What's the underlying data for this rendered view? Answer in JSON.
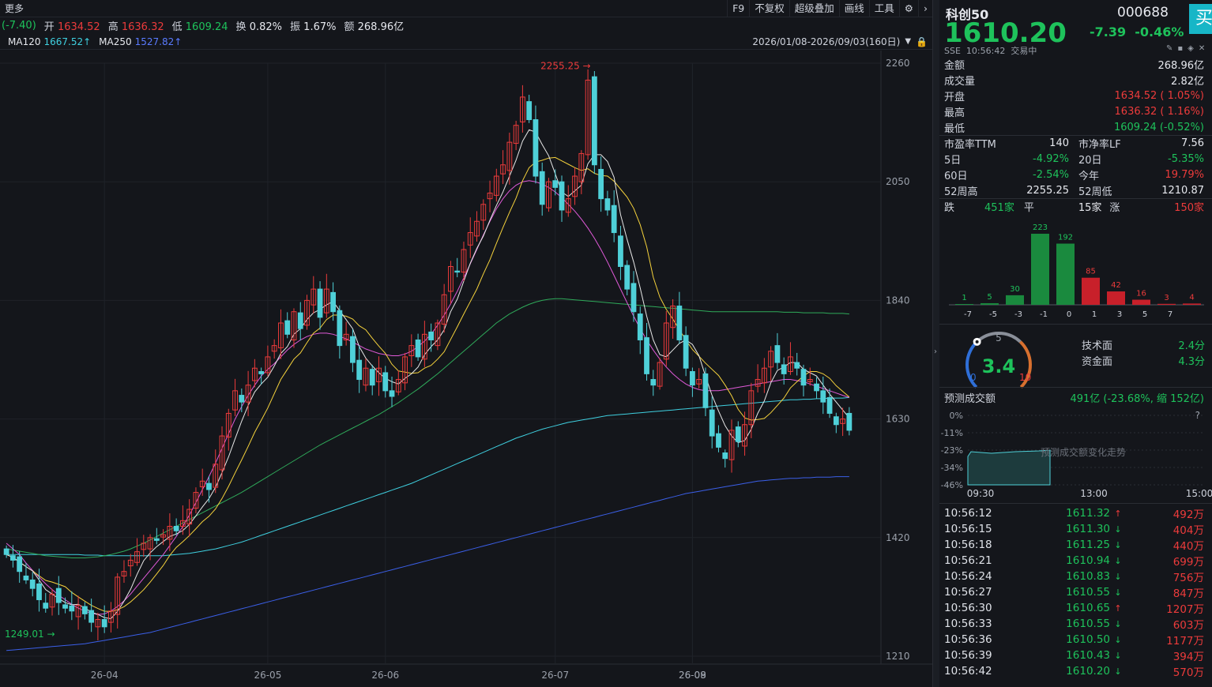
{
  "toolbar": {
    "more": "更多",
    "items": [
      "F9",
      "不复权",
      "超级叠加",
      "画线",
      "工具"
    ]
  },
  "quote": {
    "change": "(-7.40)",
    "open_label": "开",
    "open": "1634.52",
    "high_label": "高",
    "high": "1636.32",
    "low_label": "低",
    "low": "1609.24",
    "turnover_label": "换",
    "turnover": "0.82%",
    "amplitude_label": "振",
    "amplitude": "1.67%",
    "amount_label": "额",
    "amount": "268.96亿"
  },
  "ma": {
    "ma120_label": "MA120",
    "ma120": "1667.52↑",
    "ma250_label": "MA250",
    "ma250": "1527.82↑",
    "range": "2026/01/08-2026/09/03(160日)"
  },
  "colors": {
    "up": "#ec3b3b",
    "down": "#4fd0d8",
    "ma5": "#e8e8e8",
    "ma10": "#f5d23c",
    "ma20": "#e05ad8",
    "ma60": "#2faa5a",
    "ma120": "#3fd0e0",
    "ma250": "#3b5fe8"
  },
  "chart_data": {
    "type": "candlestick",
    "y_ticks": [
      "2260",
      "2050",
      "1840",
      "1630",
      "1420",
      "1210"
    ],
    "ylim": [
      1210,
      2260
    ],
    "x_ticks": [
      "26-04",
      "26-05",
      "26-06",
      "26-07",
      "26-08",
      "26-09"
    ],
    "annotations": {
      "high": "2255.25",
      "low": "1249.01"
    },
    "closes": [
      1390,
      1380,
      1360,
      1345,
      1330,
      1310,
      1295,
      1320,
      1305,
      1295,
      1290,
      1300,
      1285,
      1270,
      1275,
      1262,
      1290,
      1350,
      1360,
      1380,
      1395,
      1410,
      1420,
      1415,
      1425,
      1440,
      1432,
      1450,
      1470,
      1500,
      1520,
      1505,
      1550,
      1600,
      1640,
      1680,
      1660,
      1690,
      1720,
      1710,
      1740,
      1760,
      1800,
      1780,
      1820,
      1790,
      1840,
      1860,
      1810,
      1860,
      1820,
      1760,
      1780,
      1730,
      1700,
      1720,
      1690,
      1720,
      1680,
      1670,
      1700,
      1740,
      1760,
      1740,
      1780,
      1770,
      1800,
      1850,
      1900,
      1890,
      1930,
      1960,
      1980,
      2010,
      2030,
      2060,
      2080,
      2120,
      2150,
      2200,
      2160,
      2060,
      2010,
      2050,
      2040,
      2000,
      2020,
      2060,
      2100,
      2230,
      2080,
      2020,
      2000,
      1960,
      1900,
      1860,
      1820,
      1770,
      1710,
      1690,
      1730,
      1800,
      1830,
      1770,
      1720,
      1690,
      1700,
      1650,
      1600,
      1580,
      1560,
      1610,
      1590,
      1620,
      1680,
      1700,
      1720,
      1750,
      1730,
      1710,
      1740,
      1720,
      1690,
      1700,
      1680,
      1660,
      1640,
      1620,
      1630,
      1610
    ],
    "ma20": [
      1410,
      1400,
      1390,
      1375,
      1362,
      1350,
      1338,
      1328,
      1318,
      1310,
      1302,
      1295,
      1290,
      1286,
      1284,
      1285,
      1290,
      1298,
      1308,
      1320,
      1334,
      1348,
      1362,
      1376,
      1390,
      1406,
      1422,
      1440,
      1460,
      1482,
      1505,
      1528,
      1552,
      1578,
      1604,
      1630,
      1652,
      1672,
      1690,
      1706,
      1718,
      1728,
      1740,
      1752,
      1762,
      1770,
      1776,
      1780,
      1782,
      1782,
      1780,
      1776,
      1772,
      1766,
      1760,
      1754,
      1750,
      1746,
      1744,
      1742,
      1742,
      1745,
      1750,
      1758,
      1768,
      1780,
      1796,
      1814,
      1834,
      1856,
      1880,
      1905,
      1930,
      1956,
      1980,
      2002,
      2020,
      2034,
      2044,
      2050,
      2052,
      2050,
      2046,
      2040,
      2032,
      2022,
      2010,
      1998,
      1984,
      1968,
      1950,
      1930,
      1908,
      1884,
      1860,
      1836,
      1812,
      1790,
      1770,
      1752,
      1736,
      1722,
      1710,
      1700,
      1692,
      1686,
      1682,
      1680,
      1680,
      1680,
      1682,
      1684,
      1686,
      1688,
      1690,
      1692,
      1694,
      1696,
      1698,
      1700,
      1700,
      1698,
      1696,
      1692,
      1688,
      1684,
      1680,
      1676,
      1672,
      1668
    ],
    "ma60": [
      1400,
      1398,
      1396,
      1394,
      1392,
      1390,
      1388,
      1387,
      1386,
      1385,
      1384,
      1384,
      1384,
      1385,
      1386,
      1388,
      1390,
      1393,
      1396,
      1400,
      1405,
      1410,
      1416,
      1422,
      1428,
      1434,
      1440,
      1446,
      1452,
      1458,
      1464,
      1470,
      1476,
      1482,
      1488,
      1494,
      1500,
      1507,
      1514,
      1521,
      1528,
      1535,
      1542,
      1549,
      1556,
      1563,
      1570,
      1577,
      1584,
      1590,
      1596,
      1602,
      1608,
      1614,
      1620,
      1626,
      1632,
      1638,
      1645,
      1652,
      1659,
      1667,
      1675,
      1683,
      1692,
      1701,
      1710,
      1720,
      1730,
      1740,
      1750,
      1760,
      1770,
      1780,
      1790,
      1800,
      1808,
      1816,
      1822,
      1828,
      1833,
      1837,
      1840,
      1842,
      1843,
      1843,
      1842,
      1841,
      1840,
      1839,
      1838,
      1837,
      1836,
      1835,
      1834,
      1833,
      1832,
      1831,
      1830,
      1829,
      1828,
      1827,
      1826,
      1825,
      1824,
      1823,
      1822,
      1821,
      1820,
      1820,
      1820,
      1820,
      1820,
      1820,
      1820,
      1820,
      1820,
      1820,
      1820,
      1819,
      1819,
      1819,
      1818,
      1818,
      1818,
      1818,
      1817,
      1817,
      1817,
      1816
    ],
    "ma120": [
      1390,
      1390,
      1390,
      1390,
      1390,
      1390,
      1390,
      1390,
      1390,
      1390,
      1390,
      1390,
      1389,
      1389,
      1389,
      1388,
      1388,
      1388,
      1388,
      1388,
      1388,
      1388,
      1388,
      1388,
      1388,
      1389,
      1390,
      1391,
      1392,
      1394,
      1396,
      1398,
      1400,
      1403,
      1406,
      1409,
      1412,
      1416,
      1420,
      1424,
      1428,
      1432,
      1436,
      1440,
      1444,
      1448,
      1452,
      1456,
      1460,
      1464,
      1468,
      1472,
      1476,
      1480,
      1484,
      1488,
      1492,
      1496,
      1500,
      1504,
      1508,
      1512,
      1516,
      1521,
      1526,
      1531,
      1536,
      1541,
      1546,
      1551,
      1556,
      1561,
      1566,
      1571,
      1576,
      1581,
      1586,
      1591,
      1596,
      1600,
      1604,
      1608,
      1612,
      1615,
      1618,
      1621,
      1624,
      1626,
      1628,
      1630,
      1632,
      1634,
      1636,
      1637,
      1638,
      1639,
      1640,
      1641,
      1642,
      1643,
      1644,
      1645,
      1646,
      1647,
      1648,
      1649,
      1650,
      1651,
      1652,
      1653,
      1654,
      1655,
      1656,
      1657,
      1658,
      1659,
      1660,
      1661,
      1662,
      1663,
      1664,
      1664,
      1665,
      1665,
      1666,
      1666,
      1667,
      1667,
      1667,
      1668
    ],
    "ma250": [
      1220,
      1221,
      1222,
      1223,
      1224,
      1225,
      1226,
      1227,
      1228,
      1229,
      1230,
      1231,
      1232,
      1234,
      1236,
      1238,
      1240,
      1242,
      1244,
      1246,
      1248,
      1250,
      1252,
      1255,
      1258,
      1261,
      1264,
      1267,
      1270,
      1273,
      1276,
      1279,
      1282,
      1285,
      1288,
      1291,
      1294,
      1297,
      1300,
      1303,
      1306,
      1309,
      1312,
      1315,
      1318,
      1321,
      1324,
      1327,
      1330,
      1333,
      1336,
      1339,
      1342,
      1345,
      1348,
      1351,
      1354,
      1357,
      1360,
      1363,
      1366,
      1369,
      1372,
      1375,
      1378,
      1381,
      1384,
      1387,
      1390,
      1393,
      1396,
      1399,
      1402,
      1405,
      1408,
      1411,
      1414,
      1417,
      1420,
      1423,
      1426,
      1429,
      1432,
      1435,
      1438,
      1441,
      1444,
      1447,
      1450,
      1453,
      1456,
      1459,
      1462,
      1465,
      1468,
      1471,
      1474,
      1477,
      1480,
      1483,
      1486,
      1489,
      1492,
      1495,
      1498,
      1500,
      1502,
      1504,
      1506,
      1508,
      1510,
      1512,
      1514,
      1516,
      1518,
      1520,
      1521,
      1522,
      1523,
      1524,
      1525,
      1525,
      1526,
      1526,
      1527,
      1527,
      1527,
      1528,
      1528,
      1528
    ]
  },
  "right": {
    "name": "科创50",
    "code": "000688",
    "buy": "买",
    "price": "1610.20",
    "change": "-7.39",
    "change_pct": "-0.46%",
    "exchange": "SSE",
    "time": "10:56:42",
    "status": "交易中",
    "stats": [
      {
        "label": "金额",
        "value": "268.96亿",
        "color": "#e6e8ee"
      },
      {
        "label": "成交量",
        "value": "2.82亿",
        "color": "#e6e8ee"
      },
      {
        "label": "开盘",
        "value": "1634.52 ( 1.05%)",
        "color": "#ec3b3b"
      },
      {
        "label": "最高",
        "value": "1636.32 ( 1.16%)",
        "color": "#ec3b3b"
      },
      {
        "label": "最低",
        "value": "1609.24 (-0.52%)",
        "color": "#1ec25b"
      }
    ],
    "ratios": [
      {
        "l1": "市盈率TTM",
        "v1": "140",
        "c1": "#e6e8ee",
        "l2": "市净率LF",
        "v2": "7.56",
        "c2": "#e6e8ee"
      },
      {
        "l1": "5日",
        "v1": "-4.92%",
        "c1": "#1ec25b",
        "l2": "20日",
        "v2": "-5.35%",
        "c2": "#1ec25b"
      },
      {
        "l1": "60日",
        "v1": "-2.54%",
        "c1": "#1ec25b",
        "l2": "今年",
        "v2": "19.79%",
        "c2": "#ec3b3b"
      },
      {
        "l1": "52周高",
        "v1": "2255.25",
        "c1": "#e6e8ee",
        "l2": "52周低",
        "v2": "1210.87",
        "c2": "#e6e8ee"
      }
    ],
    "breadth": {
      "down_label": "跌",
      "down": "451家",
      "flat_label": "平",
      "flat": "15家",
      "up_label": "涨",
      "up": "150家"
    },
    "dist": {
      "labels": [
        "-7",
        "-5",
        "-3",
        "-1",
        "0",
        "1",
        "3",
        "5",
        "7"
      ],
      "values": [
        1,
        5,
        30,
        223,
        192,
        85,
        42,
        16,
        3,
        4
      ],
      "value_labels": [
        "1",
        "5",
        "30",
        "223",
        "192",
        "85",
        "42",
        "16",
        "3",
        "4"
      ]
    },
    "score": {
      "value": "3.4",
      "min": "0",
      "mid": "5",
      "max": "10",
      "tech_label": "技术面",
      "tech": "2.4分",
      "fund_label": "资金面",
      "fund": "4.3分"
    },
    "forecast": {
      "label": "预测成交额",
      "value": "491亿 (-23.68%, 缩 152亿)",
      "y_ticks": [
        "0%",
        "-11%",
        "-23%",
        "-34%",
        "-46%"
      ],
      "x_ticks": [
        "09:30",
        "13:00",
        "15:00"
      ],
      "note": "预测成交额变化走势",
      "help": "?"
    },
    "ticks": [
      {
        "time": "10:56:12",
        "price": "1611.32",
        "dir": "up",
        "vol": "492万"
      },
      {
        "time": "10:56:15",
        "price": "1611.30",
        "dir": "down",
        "vol": "404万"
      },
      {
        "time": "10:56:18",
        "price": "1611.25",
        "dir": "down",
        "vol": "440万"
      },
      {
        "time": "10:56:21",
        "price": "1610.94",
        "dir": "down",
        "vol": "699万"
      },
      {
        "time": "10:56:24",
        "price": "1610.83",
        "dir": "down",
        "vol": "756万"
      },
      {
        "time": "10:56:27",
        "price": "1610.55",
        "dir": "down",
        "vol": "847万"
      },
      {
        "time": "10:56:30",
        "price": "1610.65",
        "dir": "up",
        "vol": "1207万"
      },
      {
        "time": "10:56:33",
        "price": "1610.55",
        "dir": "down",
        "vol": "603万"
      },
      {
        "time": "10:56:36",
        "price": "1610.50",
        "dir": "down",
        "vol": "1177万"
      },
      {
        "time": "10:56:39",
        "price": "1610.43",
        "dir": "down",
        "vol": "394万"
      },
      {
        "time": "10:56:42",
        "price": "1610.20",
        "dir": "down",
        "vol": "570万"
      }
    ]
  }
}
